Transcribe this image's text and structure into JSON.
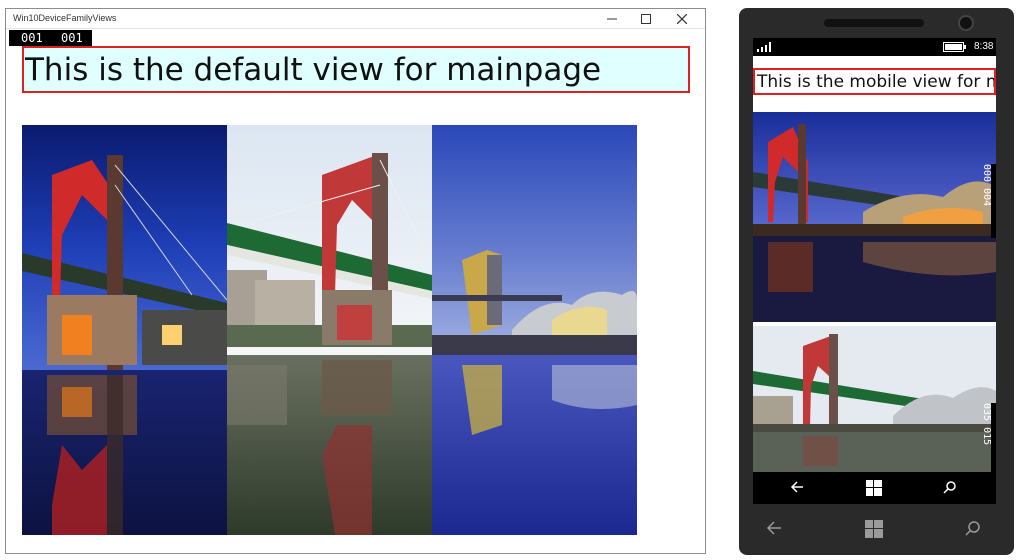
{
  "window": {
    "title": "Win10DeviceFamilyViews",
    "counter_left": "001",
    "counter_right": "001",
    "headline": "This is the default view for mainpage",
    "controls": [
      "minimize-icon",
      "maximize-icon",
      "close-icon"
    ]
  },
  "phone": {
    "status_time": "8:38",
    "headline": "This is the mobile view for mainpage",
    "counter_top": "000  004",
    "counter_bottom": "035  015",
    "nav_icons": [
      "back-icon",
      "windows-icon",
      "search-icon"
    ]
  },
  "colors": {
    "headline_border": "#e02020",
    "headline_background": "#e0ffff",
    "counter_background": "#000000"
  }
}
